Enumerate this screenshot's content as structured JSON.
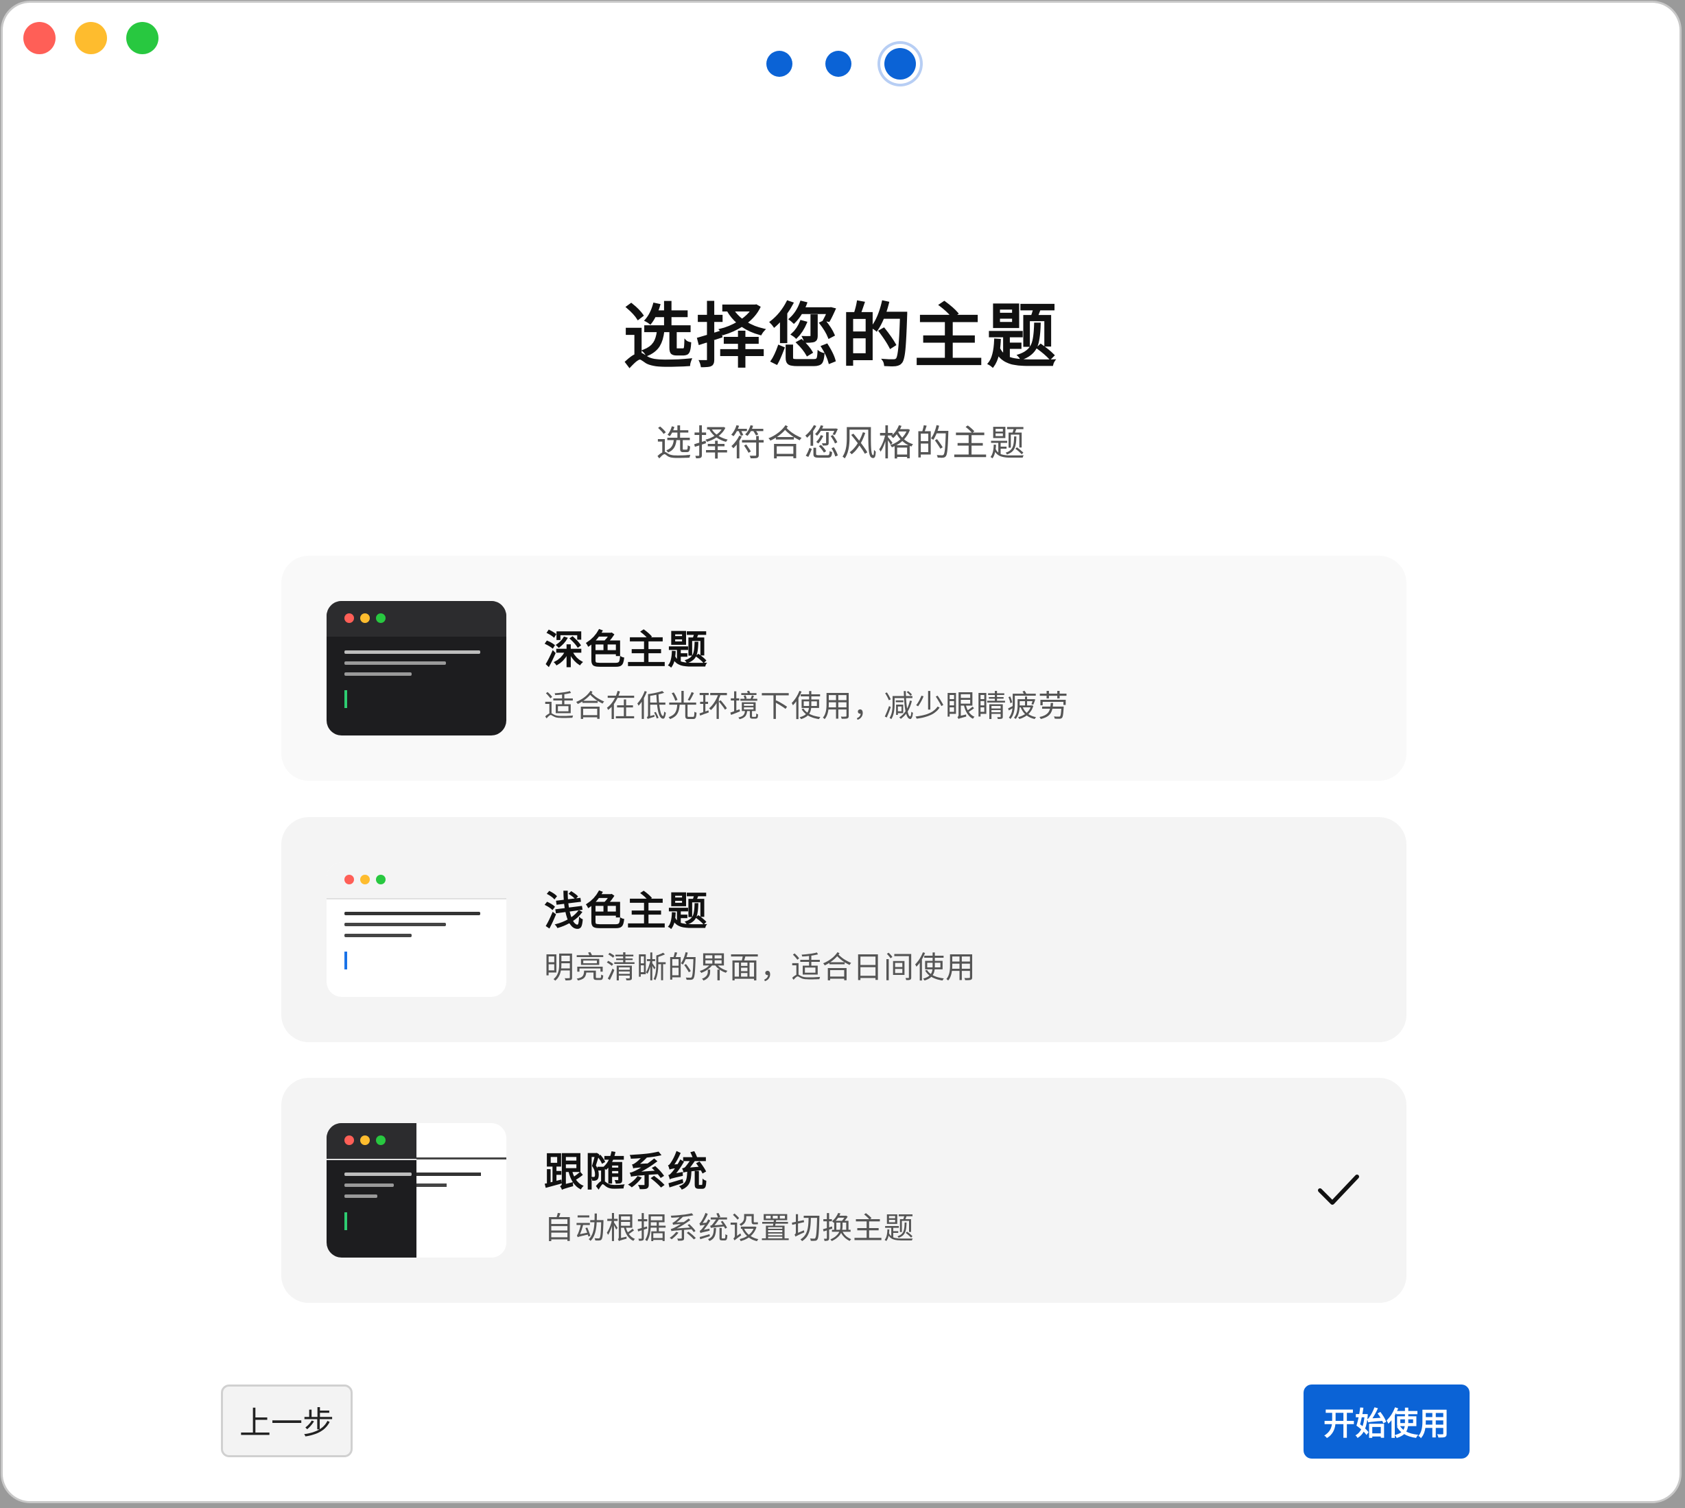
{
  "window": {
    "controls": [
      "close",
      "minimize",
      "zoom"
    ]
  },
  "progress": {
    "total_steps": 3,
    "current_step": 3
  },
  "header": {
    "title": "选择您的主题",
    "subtitle": "选择符合您风格的主题"
  },
  "themes": [
    {
      "title": "深色主题",
      "description": "适合在低光环境下使用，减少眼睛疲劳",
      "preview": "dark",
      "selected": false
    },
    {
      "title": "浅色主题",
      "description": "明亮清晰的界面，适合日间使用",
      "preview": "light",
      "selected": false
    },
    {
      "title": "跟随系统",
      "description": "自动根据系统设置切换主题",
      "preview": "auto",
      "selected": true
    }
  ],
  "footer": {
    "back_label": "上一步",
    "start_label": "开始使用"
  },
  "colors": {
    "accent": "#0b63d6",
    "close": "#ff5f57",
    "minimize": "#febc2e",
    "zoom": "#28c840",
    "check": "#111111"
  },
  "icons": {
    "selected_mark": "checkmark-icon"
  }
}
